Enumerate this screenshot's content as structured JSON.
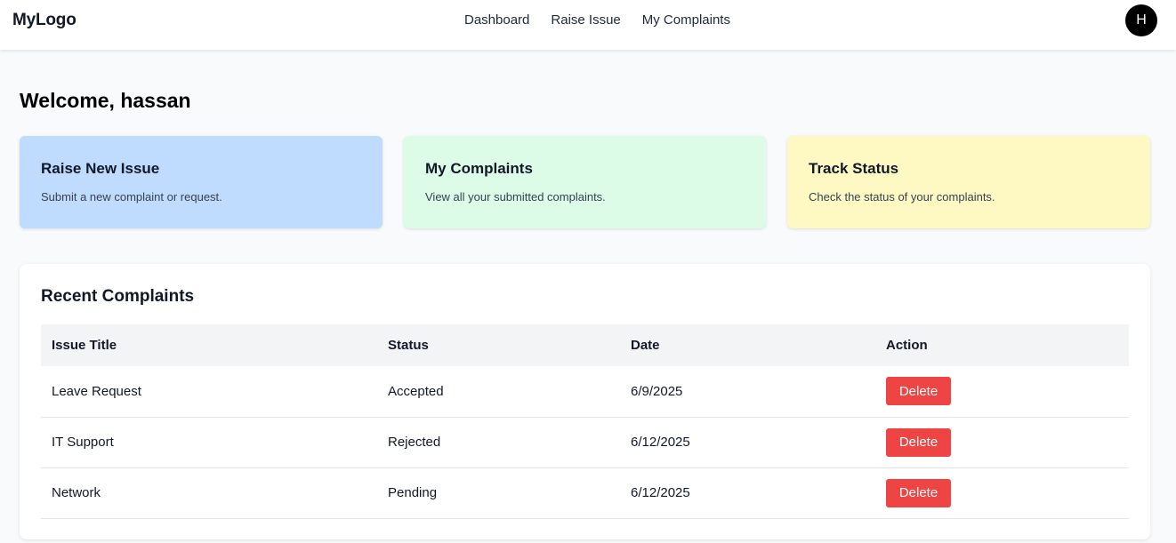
{
  "navbar": {
    "logo": "MyLogo",
    "links": [
      "Dashboard",
      "Raise Issue",
      "My Complaints"
    ],
    "avatar_initial": "H"
  },
  "welcome": "Welcome, hassan",
  "cards": [
    {
      "title": "Raise New Issue",
      "description": "Submit a new complaint or request.",
      "color": "#bfdbfe"
    },
    {
      "title": "My Complaints",
      "description": "View all your submitted complaints.",
      "color": "#dcfce7"
    },
    {
      "title": "Track Status",
      "description": "Check the status of your complaints.",
      "color": "#fef9c3"
    }
  ],
  "recent": {
    "title": "Recent Complaints",
    "headers": [
      "Issue Title",
      "Status",
      "Date",
      "Action"
    ],
    "rows": [
      {
        "title": "Leave Request",
        "status": "Accepted",
        "date": "6/9/2025",
        "action": "Delete"
      },
      {
        "title": "IT Support",
        "status": "Rejected",
        "date": "6/12/2025",
        "action": "Delete"
      },
      {
        "title": "Network",
        "status": "Pending",
        "date": "6/12/2025",
        "action": "Delete"
      }
    ]
  },
  "colors": {
    "accepted": "#16a34a",
    "rejected": "#dc2626",
    "pending": "#ca8a04",
    "delete_button": "#ef4444"
  }
}
